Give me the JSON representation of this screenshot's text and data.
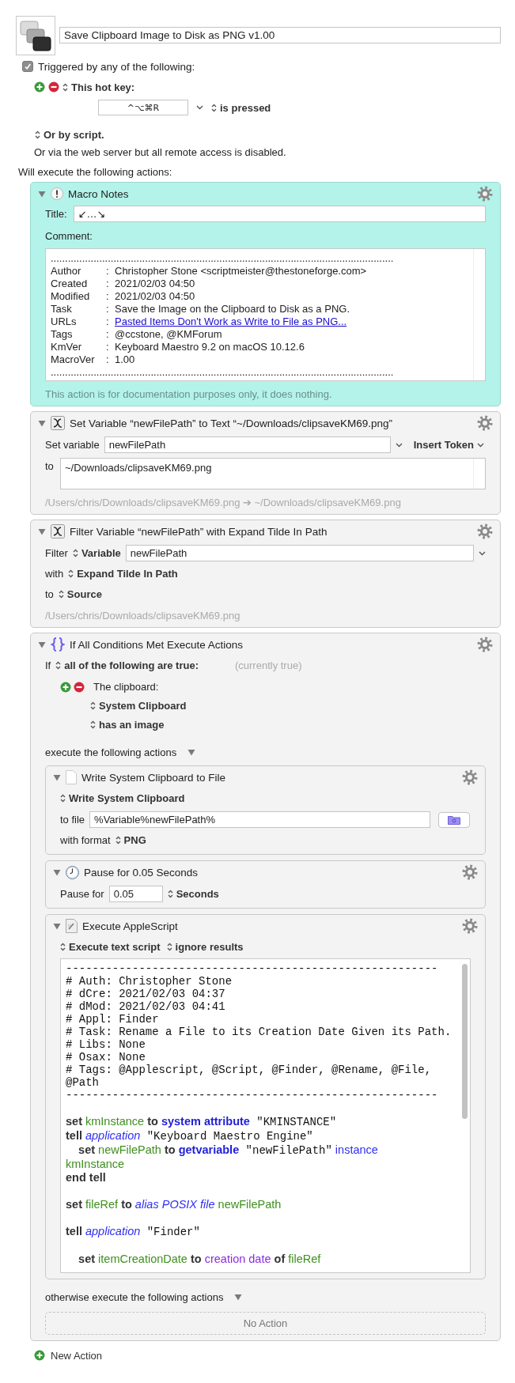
{
  "macro": {
    "name": "Save Clipboard Image to Disk as PNG v1.00"
  },
  "trigger": {
    "checked": true,
    "label": "Triggered by any of the following:",
    "hotkey_type": "This hot key:",
    "hotkey": "^⌥⌘R",
    "hotkey_state": "is pressed",
    "script_option": "Or by script.",
    "web_note": "Or via the web server but all remote access is disabled."
  },
  "actions_heading": "Will execute the following actions:",
  "actions": [
    {
      "kind": "notes",
      "title": "Macro Notes",
      "title_label": "Title:",
      "title_value": "↙…↘",
      "comment_label": "Comment:",
      "comment_lines": [
        {
          "kind": "rule",
          "text": "........................................................................................................................"
        },
        {
          "kind": "field",
          "label": "Author",
          "sep": ":",
          "value": "Christopher Stone <scriptmeister@thestoneforge.com>"
        },
        {
          "kind": "field",
          "label": "Created",
          "sep": ":",
          "value": "2021/02/03 04:50"
        },
        {
          "kind": "field",
          "label": "Modified",
          "sep": ":",
          "value": "2021/02/03 04:50"
        },
        {
          "kind": "field",
          "label": "Task",
          "sep": ":",
          "value": "Save the Image on the Clipboard to Disk as a PNG."
        },
        {
          "kind": "link",
          "label": "URLs",
          "sep": ":",
          "value": "Pasted Items Don't Work as Write to File as PNG..."
        },
        {
          "kind": "field",
          "label": "Tags",
          "sep": ":",
          "value": "@ccstone, @KMForum"
        },
        {
          "kind": "field",
          "label": "KmVer",
          "sep": ":",
          "value": "Keyboard Maestro 9.2 on macOS 10.12.6"
        },
        {
          "kind": "field",
          "label": "MacroVer",
          "sep": ":",
          "value": "1.00"
        },
        {
          "kind": "rule",
          "text": "........................................................................................................................"
        }
      ],
      "footer": "This action is for documentation purposes only, it does nothing."
    },
    {
      "kind": "set_variable",
      "title": "Set Variable “newFilePath” to Text “~/Downloads/clipsaveKM69.png”",
      "var_label": "Set variable",
      "var_value": "newFilePath",
      "token_button": "Insert Token",
      "to_label": "to",
      "to_value": "~/Downloads/clipsaveKM69.png",
      "preview": "/Users/chris/Downloads/clipsaveKM69.png ➔ ~/Downloads/clipsaveKM69.png"
    },
    {
      "kind": "filter_variable",
      "title": "Filter Variable “newFilePath” with Expand Tilde In Path",
      "filter_label": "Filter",
      "source_type": "Variable",
      "var_value": "newFilePath",
      "with_label": "with",
      "filter": "Expand Tilde In Path",
      "to_label": "to",
      "target": "Source",
      "preview": "/Users/chris/Downloads/clipsaveKM69.png"
    },
    {
      "kind": "if",
      "title": "If All Conditions Met Execute Actions",
      "if_label": "If",
      "mode": "all of the following are true:",
      "status": "(currently true)",
      "conditions": [
        {
          "title": "The clipboard:",
          "options": [
            "System Clipboard",
            "has an image"
          ]
        }
      ],
      "then_label": "execute the following actions",
      "then_actions": [
        {
          "kind": "write_file",
          "title": "Write System Clipboard to File",
          "source": "Write System Clipboard",
          "file_label": "to file",
          "file_value": "%Variable%newFilePath%",
          "format_label": "with format",
          "format": "PNG"
        },
        {
          "kind": "pause",
          "title": "Pause for 0.05 Seconds",
          "label": "Pause for",
          "value": "0.05",
          "unit": "Seconds"
        },
        {
          "kind": "applescript",
          "title": "Execute AppleScript",
          "mode": "Execute text script",
          "results": "ignore results",
          "lines": [
            {
              "kind": "comment",
              "text": "--------------------------------------------------------"
            },
            {
              "kind": "comment",
              "text": "# Auth: Christopher Stone"
            },
            {
              "kind": "comment",
              "text": "# dCre: 2021/02/03 04:37"
            },
            {
              "kind": "comment",
              "text": "# dMod: 2021/02/03 04:41"
            },
            {
              "kind": "comment",
              "text": "# Appl: Finder"
            },
            {
              "kind": "comment",
              "text": "# Task: Rename a File to its Creation Date Given its Path."
            },
            {
              "kind": "comment",
              "text": "# Libs: None"
            },
            {
              "kind": "comment",
              "text": "# Osax: None"
            },
            {
              "kind": "comment",
              "text": "# Tags: @Applescript, @Script, @Finder, @Rename, @File,"
            },
            {
              "kind": "comment",
              "text": "@Path"
            },
            {
              "kind": "comment",
              "text": "--------------------------------------------------------"
            },
            {
              "kind": "blank"
            },
            {
              "kind": "code",
              "tokens": [
                {
                  "kind": "keyword",
                  "text": "set"
                },
                {
                  "kind": "variable",
                  "text": " kmInstance"
                },
                {
                  "kind": "keyword",
                  "text": " to"
                },
                {
                  "kind": "command",
                  "text": " system attribute"
                },
                {
                  "kind": "string",
                  "text": " \"KMINSTANCE\""
                }
              ]
            },
            {
              "kind": "code",
              "tokens": [
                {
                  "kind": "keyword",
                  "text": "tell"
                },
                {
                  "kind": "class",
                  "text": " application"
                },
                {
                  "kind": "string",
                  "text": " \"Keyboard Maestro Engine\""
                }
              ]
            },
            {
              "kind": "code",
              "tokens": [
                {
                  "kind": "keyword",
                  "text": "    set"
                },
                {
                  "kind": "variable",
                  "text": " newFilePath"
                },
                {
                  "kind": "keyword",
                  "text": " to"
                },
                {
                  "kind": "command",
                  "text": " getvariable"
                },
                {
                  "kind": "string",
                  "text": " \"newFilePath\""
                },
                {
                  "kind": "parameter",
                  "text": " instance"
                }
              ]
            },
            {
              "kind": "code",
              "tokens": [
                {
                  "kind": "variable",
                  "text": "kmInstance"
                }
              ]
            },
            {
              "kind": "code",
              "tokens": [
                {
                  "kind": "keyword",
                  "text": "end tell"
                }
              ]
            },
            {
              "kind": "blank"
            },
            {
              "kind": "code",
              "tokens": [
                {
                  "kind": "keyword",
                  "text": "set"
                },
                {
                  "kind": "variable",
                  "text": " fileRef"
                },
                {
                  "kind": "keyword",
                  "text": " to"
                },
                {
                  "kind": "class",
                  "text": " alias POSIX file"
                },
                {
                  "kind": "variable",
                  "text": " newFilePath"
                }
              ]
            },
            {
              "kind": "blank"
            },
            {
              "kind": "code",
              "tokens": [
                {
                  "kind": "keyword",
                  "text": "tell"
                },
                {
                  "kind": "class",
                  "text": " application"
                },
                {
                  "kind": "string",
                  "text": " \"Finder\""
                }
              ]
            },
            {
              "kind": "blank"
            },
            {
              "kind": "code",
              "tokens": [
                {
                  "kind": "keyword",
                  "text": "    set"
                },
                {
                  "kind": "variable",
                  "text": " itemCreationDate"
                },
                {
                  "kind": "keyword",
                  "text": " to"
                },
                {
                  "kind": "property",
                  "text": " creation date"
                },
                {
                  "kind": "keyword",
                  "text": " of"
                },
                {
                  "kind": "variable",
                  "text": " fileRef"
                }
              ]
            }
          ]
        }
      ],
      "else_label": "otherwise execute the following actions",
      "else_empty": "No Action"
    }
  ],
  "new_action": "New Action"
}
